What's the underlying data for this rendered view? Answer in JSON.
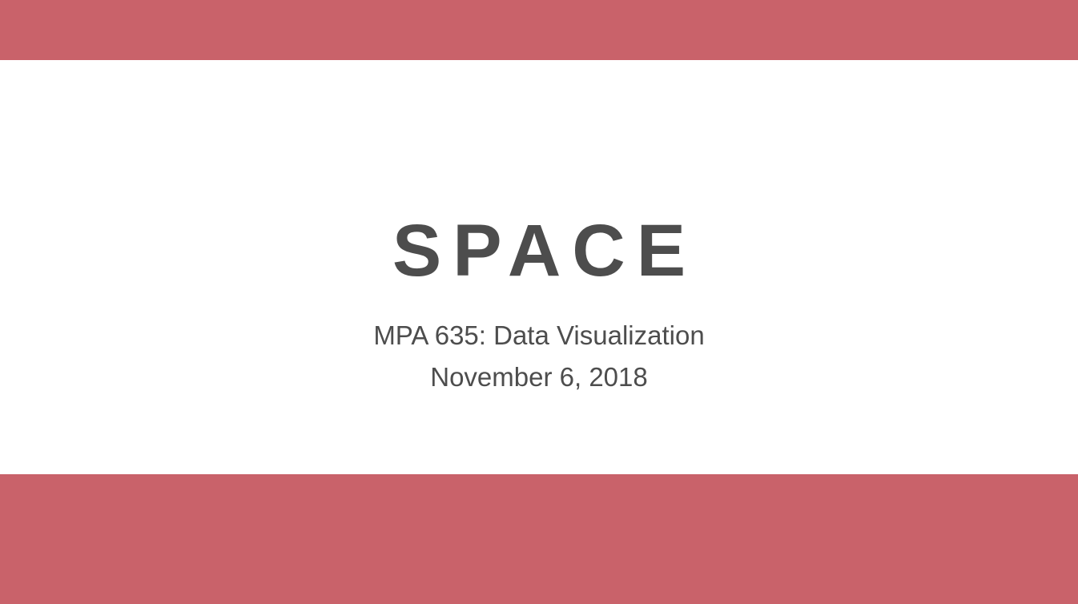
{
  "slide": {
    "title": "SPACE",
    "course": "MPA 635: Data Visualization",
    "date": "November 6, 2018"
  },
  "colors": {
    "band": "#c9626a",
    "text": "#4d4d4d",
    "background": "#ffffff"
  }
}
